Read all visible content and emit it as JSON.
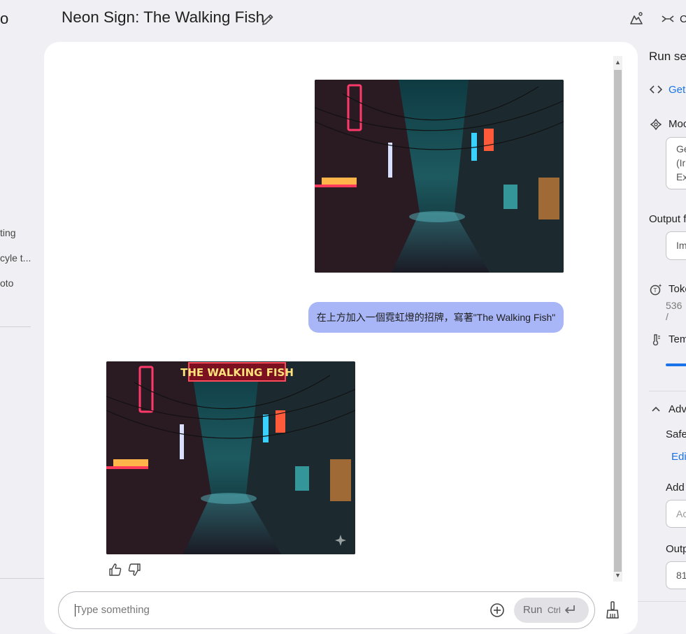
{
  "sidebar": {
    "logo_fragment": "o",
    "items": [
      "ting",
      "cyle t...",
      "oto"
    ]
  },
  "header": {
    "title": "Neon Sign: The Walking Fish",
    "right_button_fragment": "C"
  },
  "chat": {
    "user_message": "在上方加入一個霓虹燈的招牌，寫著\"The Walking Fish\"",
    "image_sign_text": "THE WALKING FISH"
  },
  "input": {
    "placeholder": "Type something",
    "run_label": "Run",
    "run_shortcut": "Ctrl"
  },
  "run_settings": {
    "title": "Run set",
    "get_code_link": "Get",
    "model_label": "Moc",
    "model_value_lines": [
      "Ge",
      "(Ir",
      "Ex"
    ],
    "output_format_label": "Output f",
    "output_format_value": "Im",
    "token_count_label": "Toke",
    "token_count_value": "536 /",
    "temperature_label": "Tem",
    "advanced_label": "Adv",
    "safety_label": "Safe",
    "edit_link": "Edi",
    "add_stop_label": "Add",
    "add_stop_placeholder": "Ac",
    "output_length_label": "Outp",
    "output_length_value": "81"
  },
  "colors": {
    "accent": "#1a73e8",
    "user_bubble": "#a8b6f7",
    "panel": "#ffffff",
    "background": "#f0f0f4"
  }
}
